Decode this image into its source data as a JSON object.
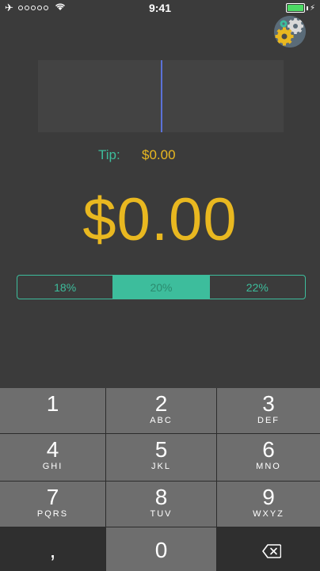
{
  "status_bar": {
    "time": "9:41"
  },
  "bill": {
    "value": ""
  },
  "tip": {
    "label": "Tip:",
    "value": "$0.00"
  },
  "total": {
    "value": "$0.00"
  },
  "tip_options": [
    {
      "label": "18%",
      "selected": false
    },
    {
      "label": "20%",
      "selected": true
    },
    {
      "label": "22%",
      "selected": false
    }
  ],
  "keypad": {
    "keys": [
      {
        "digit": "1",
        "letters": ""
      },
      {
        "digit": "2",
        "letters": "ABC"
      },
      {
        "digit": "3",
        "letters": "DEF"
      },
      {
        "digit": "4",
        "letters": "GHI"
      },
      {
        "digit": "5",
        "letters": "JKL"
      },
      {
        "digit": "6",
        "letters": "MNO"
      },
      {
        "digit": "7",
        "letters": "PQRS"
      },
      {
        "digit": "8",
        "letters": "TUV"
      },
      {
        "digit": "9",
        "letters": "WXYZ"
      },
      {
        "digit": ",",
        "letters": ""
      },
      {
        "digit": "0",
        "letters": ""
      }
    ]
  },
  "colors": {
    "background": "#3b3b3b",
    "accent_teal": "#3dbd9c",
    "accent_gold": "#e9b820",
    "cursor": "#5b72d8",
    "key": "#6e6e6e"
  },
  "icons": {
    "status": [
      "airplane-icon",
      "signal-dots-icon",
      "wifi-icon",
      "battery-icon"
    ],
    "settings": "gears-icon",
    "delete": "backspace-icon"
  }
}
